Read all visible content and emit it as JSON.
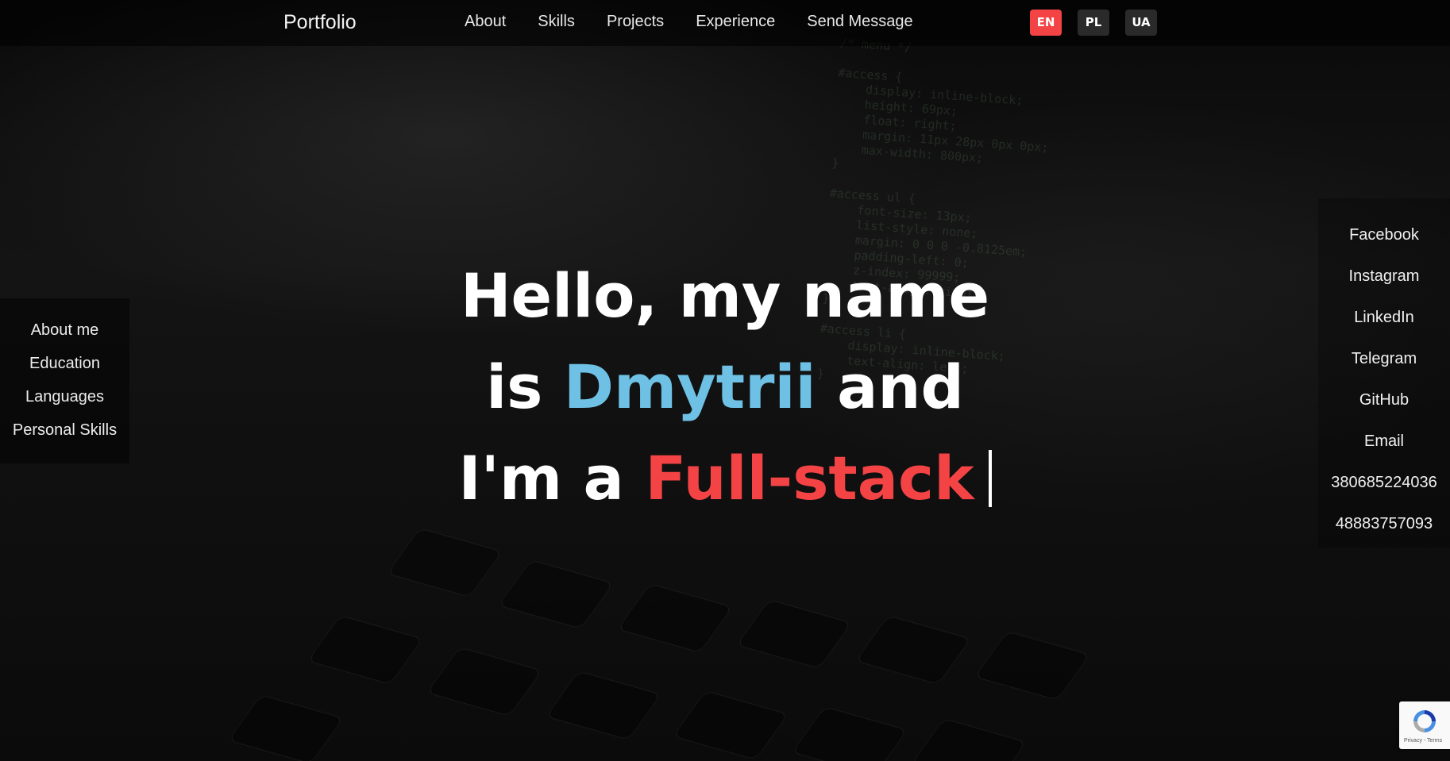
{
  "colors": {
    "accent_red": "#f44345",
    "accent_blue": "#6ec1e4",
    "text": "#ffffff"
  },
  "header": {
    "brand": "Portfolio",
    "nav": [
      "About",
      "Skills",
      "Projects",
      "Experience",
      "Send Message"
    ],
    "languages": [
      {
        "label": "EN",
        "active": true
      },
      {
        "label": "PL",
        "active": false
      },
      {
        "label": "UA",
        "active": false
      }
    ]
  },
  "left_menu": [
    "About me",
    "Education",
    "Languages",
    "Personal Skills"
  ],
  "right_links": [
    "Facebook",
    "Instagram",
    "LinkedIn",
    "Telegram",
    "GitHub",
    "Email",
    "380685224036",
    "48883757093"
  ],
  "hero": {
    "line1": "Hello, my name",
    "line2_prefix": "is",
    "name": "Dmytrii",
    "line2_suffix": "and",
    "line3_prefix": "I'm a",
    "role": "Full-stack"
  },
  "recaptcha": {
    "icon": "recaptcha-icon",
    "terms": "Privacy - Terms"
  }
}
